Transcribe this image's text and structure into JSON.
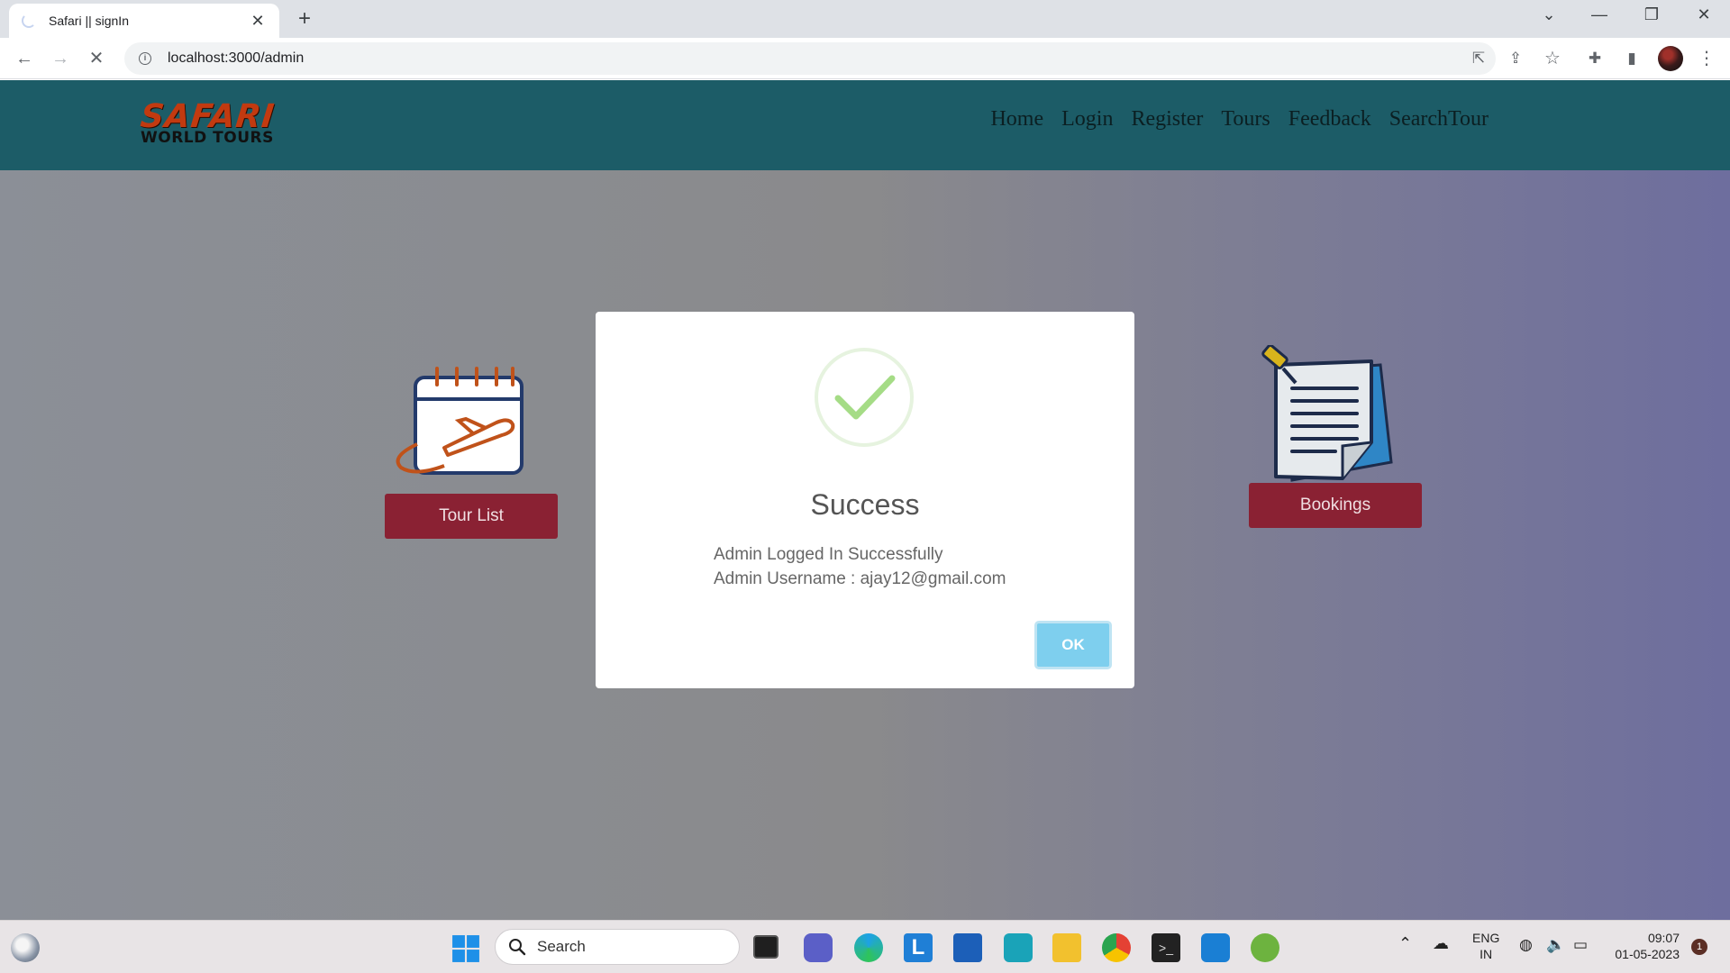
{
  "browser": {
    "tab_title": "Safari || signIn",
    "url": "localhost:3000/admin"
  },
  "site": {
    "logo_top": "SAFARI",
    "logo_bottom": "WORLD TOURS",
    "nav": [
      "Home",
      "Login",
      "Register",
      "Tours",
      "Feedback",
      "SearchTour"
    ],
    "cards": [
      {
        "label": "Tour List",
        "icon": "calendar-plane-icon"
      },
      {
        "label": "Bookings",
        "icon": "document-pin-icon"
      }
    ]
  },
  "modal": {
    "title": "Success",
    "line1": "Admin Logged In Successfully",
    "line2": "Admin Username : ajay12@gmail.com",
    "ok_label": "OK"
  },
  "taskbar": {
    "search_label": "Search",
    "lang_top": "ENG",
    "lang_bottom": "IN",
    "time": "09:07",
    "date": "01-05-2023",
    "notification_count": "1"
  },
  "colors": {
    "header": "#1c5c67",
    "button": "#8a2133",
    "ok_button": "#7ecfee",
    "check": "#a5dc86"
  }
}
